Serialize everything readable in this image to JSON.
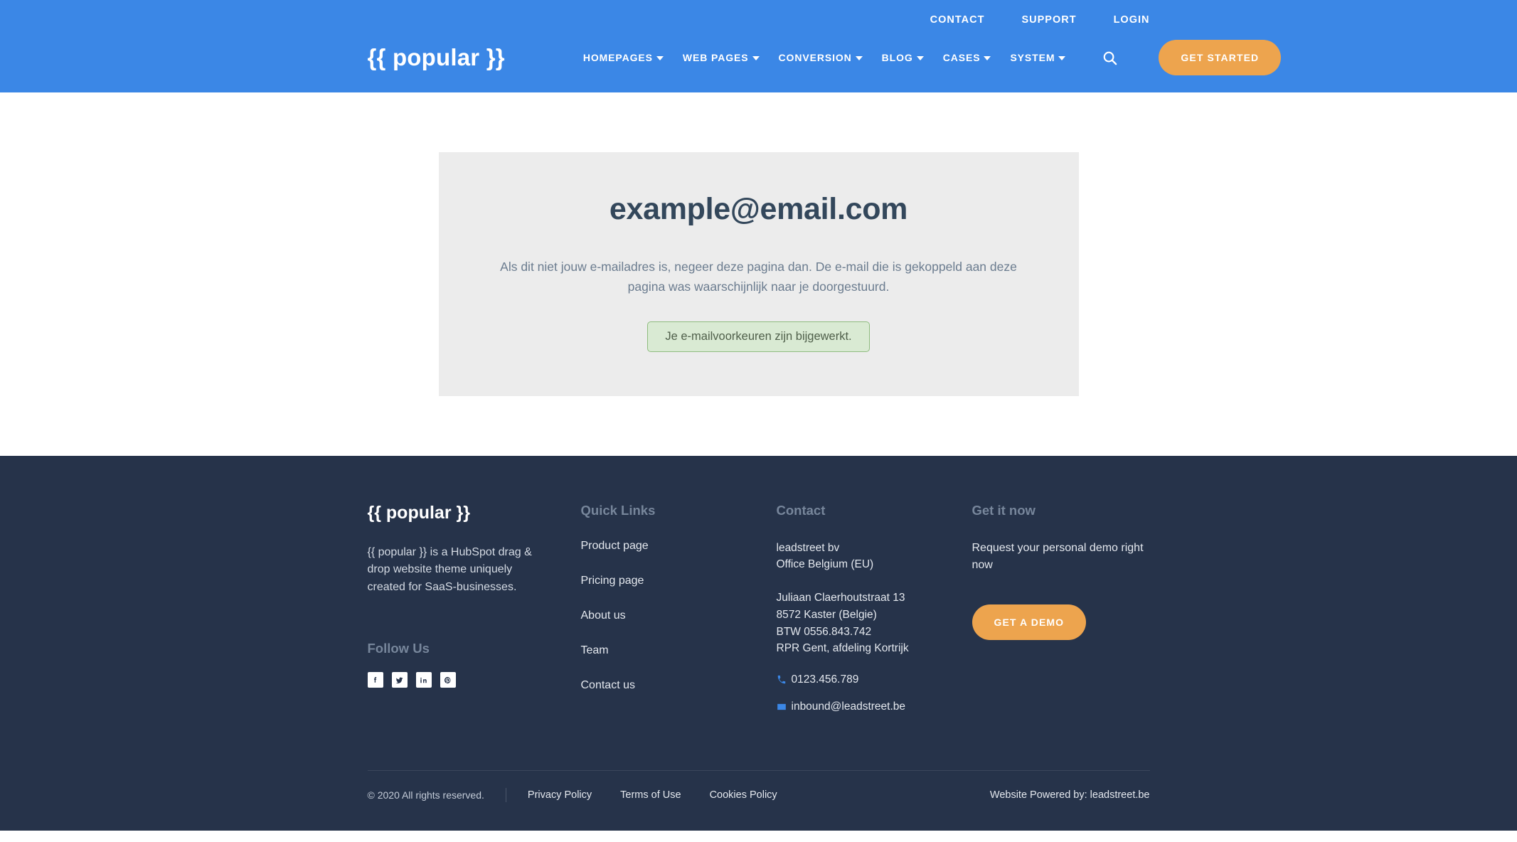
{
  "header": {
    "brand": "{{ popular }}",
    "utility_nav": [
      {
        "label": "CONTACT"
      },
      {
        "label": "SUPPORT"
      },
      {
        "label": "LOGIN"
      }
    ],
    "main_nav": [
      {
        "label": "HOMEPAGES",
        "has_dropdown": true
      },
      {
        "label": "WEB PAGES",
        "has_dropdown": true
      },
      {
        "label": "CONVERSION",
        "has_dropdown": true
      },
      {
        "label": "BLOG",
        "has_dropdown": true
      },
      {
        "label": "CASES",
        "has_dropdown": true
      },
      {
        "label": "SYSTEM",
        "has_dropdown": true
      }
    ],
    "search_icon": "search-icon",
    "cta_label": "GET STARTED",
    "background_color": "#3b87e6",
    "cta_color": "#eda44e"
  },
  "main": {
    "email": "example@email.com",
    "body_text": "Als dit niet jouw e-mailadres is, negeer deze pagina dan. De e-mail die is gekoppeld aan deze pagina was waarschijnlijk naar je doorgestuurd.",
    "alert_text": "Je e-mailvoorkeuren zijn bijgewerkt.",
    "card_background": "#ececec",
    "alert_background": "#d9ead3",
    "alert_border": "#8fbc7f"
  },
  "footer": {
    "background_color": "#26334a",
    "brand": "{{ popular }}",
    "description": "{{ popular }} is a HubSpot drag & drop website theme uniquely created for SaaS-businesses.",
    "follow_heading": "Follow Us",
    "social": [
      {
        "name": "facebook-icon",
        "label": "Facebook"
      },
      {
        "name": "twitter-icon",
        "label": "Twitter"
      },
      {
        "name": "linkedin-icon",
        "label": "LinkedIn"
      },
      {
        "name": "pinterest-icon",
        "label": "Pinterest"
      }
    ],
    "quick_links_heading": "Quick Links",
    "quick_links": [
      {
        "label": "Product page"
      },
      {
        "label": "Pricing page"
      },
      {
        "label": "About us"
      },
      {
        "label": "Team"
      },
      {
        "label": "Contact us"
      }
    ],
    "contact_heading": "Contact",
    "contact_company_1": "leadstreet bv",
    "contact_company_2": "Office Belgium (EU)",
    "contact_address_1": "Juliaan Claerhoutstraat 13",
    "contact_address_2": "8572 Kaster (Belgie)",
    "contact_address_3": "BTW 0556.843.742",
    "contact_address_4": "RPR Gent, afdeling Kortrijk",
    "phone": "0123.456.789",
    "email": "inbound@leadstreet.be",
    "demo_heading": "Get it now",
    "demo_text": "Request your personal demo right now",
    "demo_button": "GET A DEMO"
  },
  "footer_bottom": {
    "copyright": "© 2020 All rights reserved.",
    "legal": [
      {
        "label": "Privacy Policy"
      },
      {
        "label": "Terms of Use"
      },
      {
        "label": "Cookies Policy"
      }
    ],
    "powered_by": "Website Powered by: leadstreet.be"
  }
}
